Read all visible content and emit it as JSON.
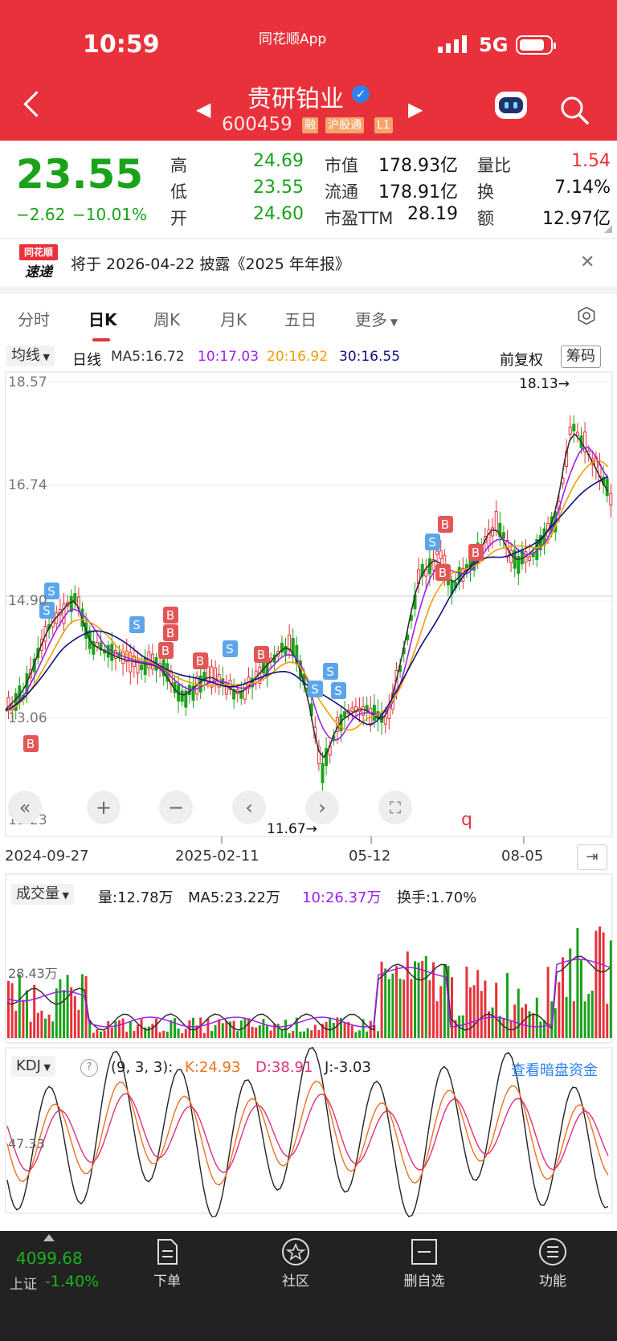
{
  "status_bar": {
    "time": "10:59",
    "carrier": "同花顺App",
    "network": "5G"
  },
  "header": {
    "stock_name": "贵研铂业",
    "code": "600459",
    "tags": [
      "融",
      "沪股通",
      "L1"
    ]
  },
  "quote": {
    "price": "23.55",
    "change": "−2.62",
    "change_pct": "−10.01%",
    "stats": [
      {
        "label": "高",
        "value": "24.69"
      },
      {
        "label": "低",
        "value": "23.55"
      },
      {
        "label": "开",
        "value": "24.60"
      },
      {
        "label": "市值",
        "value": "178.93亿"
      },
      {
        "label": "流通",
        "value": "178.91亿"
      },
      {
        "label": "市盈TTM",
        "value": "28.19"
      },
      {
        "label": "量比",
        "value": "1.54"
      },
      {
        "label": "换",
        "value": "7.14%"
      },
      {
        "label": "额",
        "value": "12.97亿"
      }
    ]
  },
  "news": {
    "logo_top": "同花顺",
    "logo_bottom": "速递",
    "text": "将于 2026-04-22 披露《2025 年年报》"
  },
  "tabs": [
    "分时",
    "日K",
    "周K",
    "月K",
    "五日",
    "更多"
  ],
  "legend": {
    "ma_dropdown": "均线",
    "period": "日线",
    "ma5": "MA5:16.72",
    "ma10": "10:17.03",
    "ma20": "20:16.92",
    "ma30": "30:16.55",
    "adjust": "前复权",
    "chips": "筹码"
  },
  "chart": {
    "y_labels": [
      "18.57",
      "16.74",
      "14.90",
      "13.06",
      "11.23"
    ],
    "high_marker": "18.13→",
    "low_marker": "11.67→",
    "x_labels": [
      "2024-09-27",
      "2025-02-11",
      "05-12",
      "08-05"
    ],
    "signals": [
      "S",
      "S",
      "B",
      "S",
      "B",
      "B",
      "B",
      "B",
      "S",
      "B",
      "S",
      "S",
      "S",
      "S",
      "B",
      "B",
      "B"
    ]
  },
  "volume": {
    "dropdown": "成交量",
    "vol": "量:12.78万",
    "ma5": "MA5:23.22万",
    "ma10": "10:26.37万",
    "turnover": "换手:1.70%",
    "y_label": "28.43万"
  },
  "kdj": {
    "dropdown": "KDJ",
    "params": "(9, 3, 3):",
    "k": "K:24.93",
    "d": "D:38.91",
    "j": "J:-3.03",
    "link": "查看暗盘资金",
    "y_label": "47.33"
  },
  "bottom_nav": {
    "index_value": "4099.68",
    "index_name": "上证",
    "index_change": "-1.40%",
    "items": [
      "下单",
      "社区",
      "删自选",
      "功能"
    ]
  },
  "colors": {
    "up": "#e8313a",
    "down": "#1aa31a",
    "ma5": "#333333",
    "ma10": "#a020f0",
    "ma20": "#f0a000",
    "ma30": "#101080"
  }
}
